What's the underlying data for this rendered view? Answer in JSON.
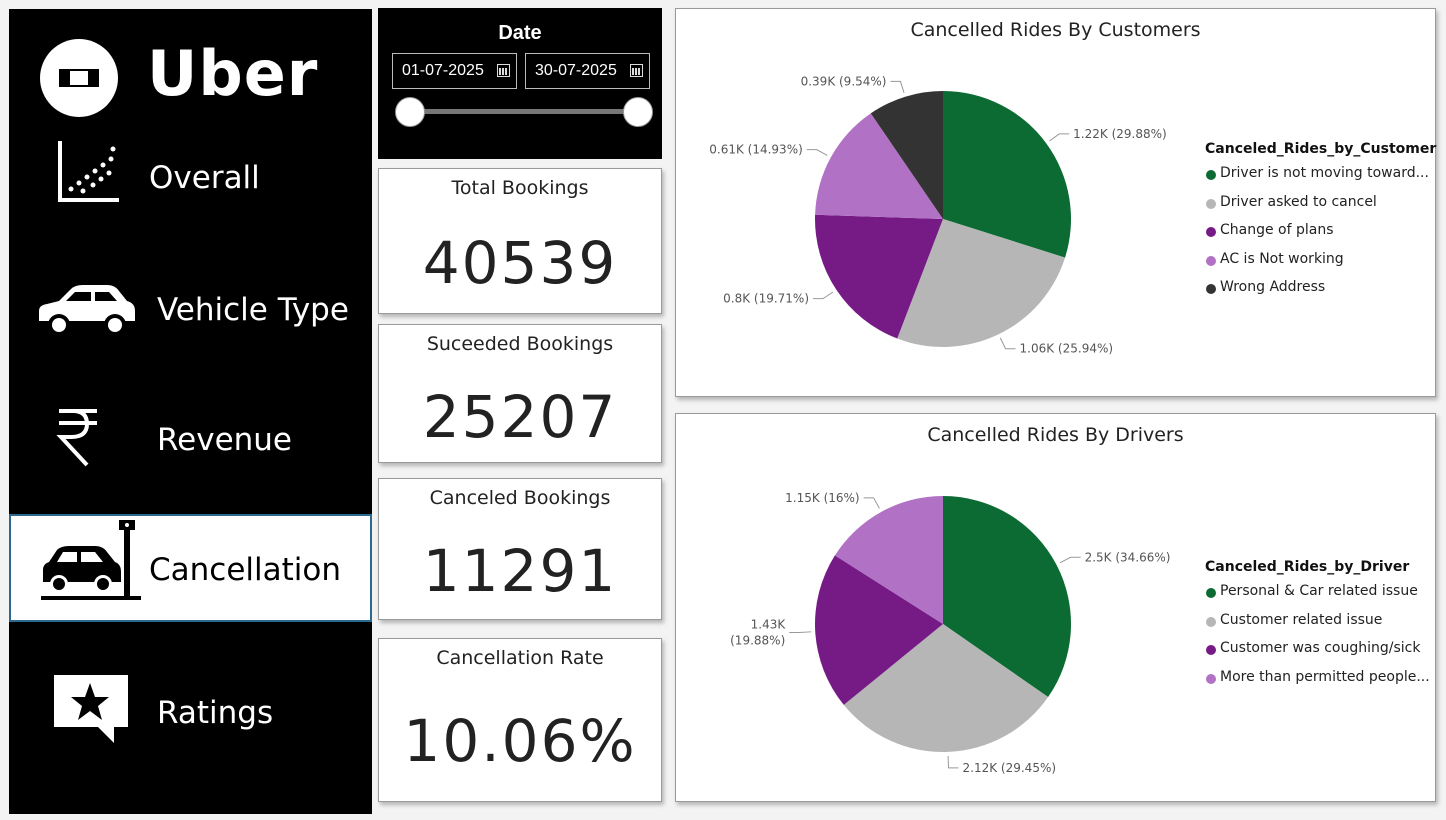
{
  "brand": {
    "name": "Uber"
  },
  "nav": {
    "items": [
      {
        "label": "Overall",
        "icon": "scatter-plot-icon"
      },
      {
        "label": "Vehicle Type",
        "icon": "car-icon"
      },
      {
        "label": "Revenue",
        "icon": "rupee-icon"
      },
      {
        "label": "Cancellation",
        "icon": "car-crash-icon",
        "active": true
      },
      {
        "label": "Ratings",
        "icon": "star-message-icon"
      }
    ]
  },
  "date_filter": {
    "title": "Date",
    "start": "01-07-2025",
    "end": "30-07-2025"
  },
  "kpis": [
    {
      "title": "Total Bookings",
      "value": "40539"
    },
    {
      "title": "Suceeded Bookings",
      "value": "25207"
    },
    {
      "title": "Canceled Bookings",
      "value": "11291"
    },
    {
      "title": "Cancellation Rate",
      "value": "10.06%"
    }
  ],
  "chart_data": [
    {
      "type": "pie",
      "title": "Cancelled Rides By Customers",
      "legend_title": "Canceled_Rides_by_Customer",
      "legend_position": "right",
      "slices": [
        {
          "name": "Driver is not moving toward...",
          "value": 1.22,
          "percent": 29.88,
          "label": "1.22K (29.88%)",
          "color": "#0b6b33"
        },
        {
          "name": "Driver asked to cancel",
          "value": 1.06,
          "percent": 25.94,
          "label": "1.06K (25.94%)",
          "color": "#b6b6b6"
        },
        {
          "name": "Change of plans",
          "value": 0.8,
          "percent": 19.71,
          "label": "0.8K (19.71%)",
          "color": "#761a86"
        },
        {
          "name": "AC is Not working",
          "value": 0.61,
          "percent": 14.93,
          "label": "0.61K (14.93%)",
          "color": "#b171c4"
        },
        {
          "name": "Wrong Address",
          "value": 0.39,
          "percent": 9.54,
          "label": "0.39K (9.54%)",
          "color": "#333333"
        }
      ]
    },
    {
      "type": "pie",
      "title": "Cancelled Rides By Drivers",
      "legend_title": "Canceled_Rides_by_Driver",
      "legend_position": "right",
      "slices": [
        {
          "name": "Personal & Car related issue",
          "value": 2.5,
          "percent": 34.66,
          "label": "2.5K (34.66%)",
          "color": "#0b6b33"
        },
        {
          "name": "Customer related issue",
          "value": 2.12,
          "percent": 29.45,
          "label": "2.12K (29.45%)",
          "color": "#b6b6b6"
        },
        {
          "name": "Customer was coughing/sick",
          "value": 1.43,
          "percent": 19.88,
          "label": "1.43K\n(19.88%)",
          "color": "#761a86"
        },
        {
          "name": "More than permitted people...",
          "value": 1.15,
          "percent": 16,
          "label": "1.15K (16%)",
          "color": "#b171c4"
        }
      ]
    }
  ]
}
